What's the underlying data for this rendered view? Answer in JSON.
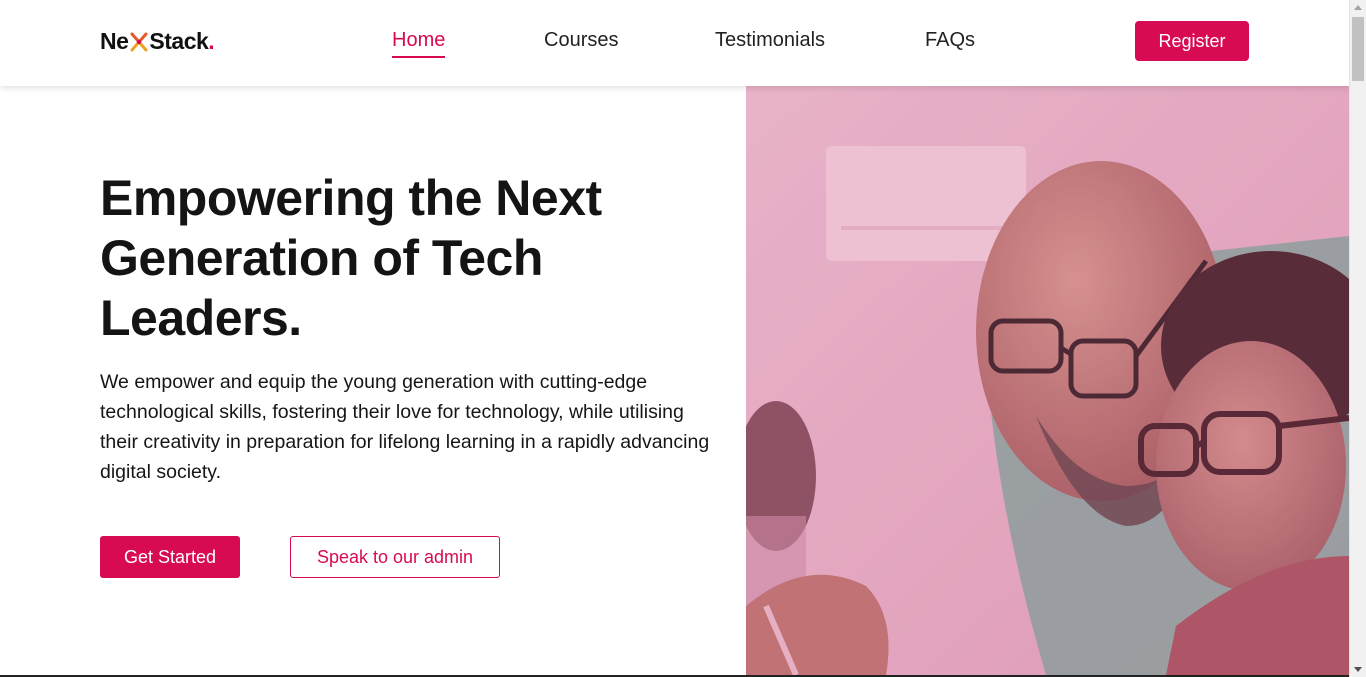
{
  "brand": {
    "name_prefix": "Ne",
    "name_suffix": "Stack",
    "dot": ".",
    "accent_color": "#d70a53"
  },
  "nav": {
    "items": [
      {
        "label": "Home",
        "active": true
      },
      {
        "label": "Courses",
        "active": false
      },
      {
        "label": "Testimonials",
        "active": false
      },
      {
        "label": "FAQs",
        "active": false
      }
    ]
  },
  "header": {
    "register_label": "Register"
  },
  "hero": {
    "title": "Empowering the Next Generation of Tech Leaders.",
    "subtitle": "We empower and equip the young generation with cutting-edge technological skills, fostering their love for technology, while utilising their creativity in preparation for lifelong learning in a rapidly advancing digital society.",
    "primary_cta": "Get Started",
    "secondary_cta": "Speak to our admin",
    "image": "photo of a man and a boy with glasses looking at a screen, pink tint"
  }
}
